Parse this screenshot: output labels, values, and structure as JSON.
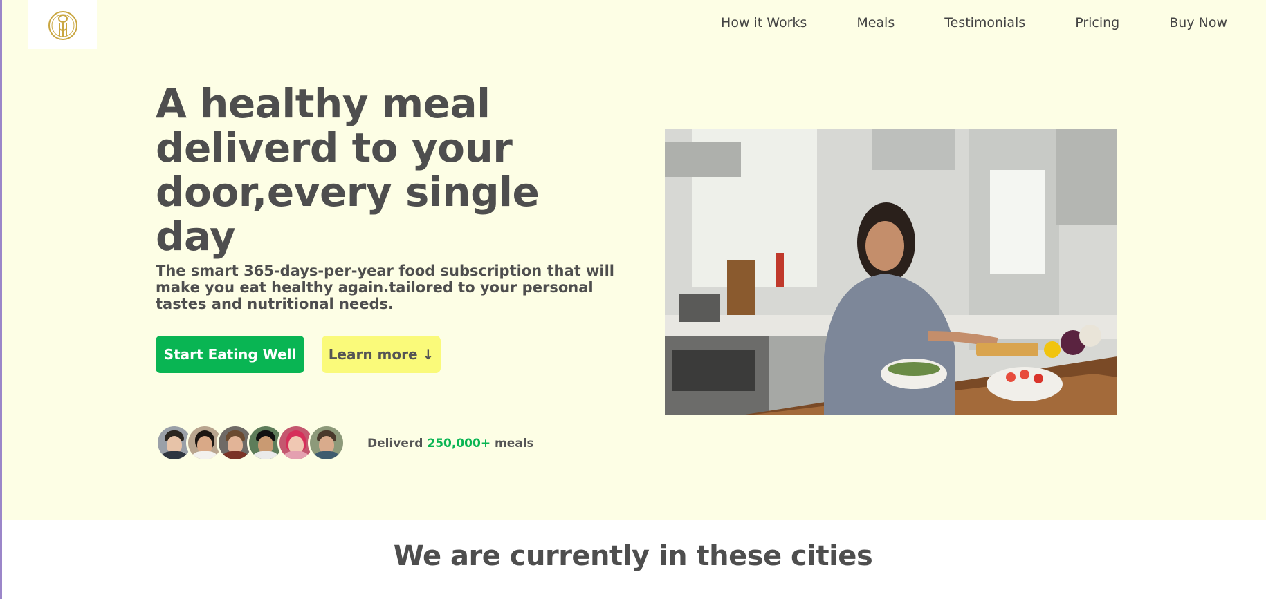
{
  "header": {
    "logo_icon": "fork-knife-logo-icon",
    "nav": [
      {
        "label": "How it Works"
      },
      {
        "label": "Meals"
      },
      {
        "label": "Testimonials"
      },
      {
        "label": "Pricing"
      },
      {
        "label": "Buy Now"
      }
    ]
  },
  "hero": {
    "title": "A healthy meal deliverd to your door,every single day",
    "description": "The smart 365-days-per-year food subscription that will make you eat healthy again.tailored to your personal tastes and nutritional needs.",
    "primary_button": "Start Eating Well",
    "secondary_button": "Learn more ↓",
    "delivered_prefix": "Deliverd",
    "delivered_count": "250,000+",
    "delivered_suffix": "meals",
    "image_alt": "Woman cooking healthy food in a kitchen"
  },
  "section": {
    "cities_title": "We are currently in these cities"
  },
  "colors": {
    "hero_bg": "#fdfee5",
    "primary": "#09b553",
    "secondary": "#fafa7a",
    "text": "#4e4e4e"
  }
}
